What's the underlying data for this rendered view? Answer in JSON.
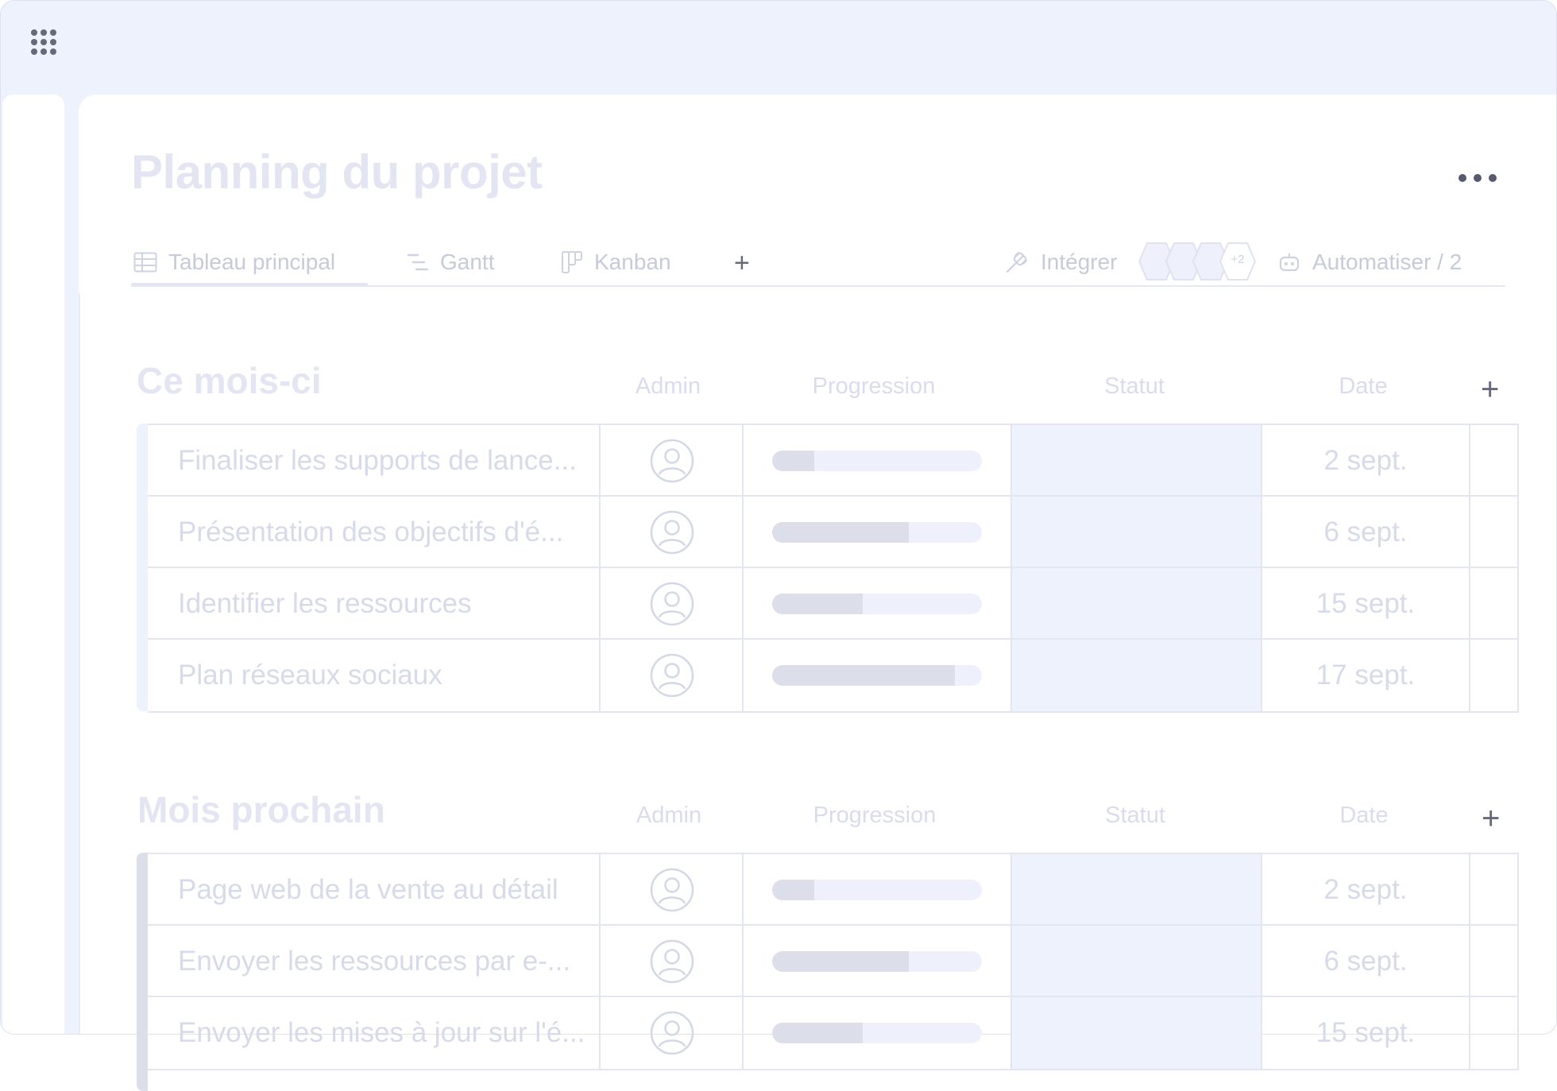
{
  "page": {
    "title": "Planning du projet"
  },
  "tabs": [
    {
      "label": "Tableau principal",
      "icon": "table-icon",
      "active": true
    },
    {
      "label": "Gantt",
      "icon": "gantt-icon"
    },
    {
      "label": "Kanban",
      "icon": "kanban-icon"
    }
  ],
  "toolbar": {
    "add_tab": "+",
    "integrate_label": "Intégrer",
    "integrate_icon": "plug-icon",
    "apps_more": "+2",
    "automate_label": "Automatiser / 2",
    "automate_icon": "robot-icon"
  },
  "columns": {
    "admin": "Admin",
    "progress": "Progression",
    "status": "Statut",
    "date": "Date",
    "add": "+"
  },
  "groups": [
    {
      "title": "Ce mois-ci",
      "color": "#eef2fd",
      "rows": [
        {
          "name": "Finaliser les supports de lance...",
          "progress": 0.2,
          "date": "2 sept."
        },
        {
          "name": "Présentation des objectifs d'é...",
          "progress": 0.65,
          "date": "6 sept."
        },
        {
          "name": "Identifier les ressources",
          "progress": 0.43,
          "date": "15 sept."
        },
        {
          "name": "Plan réseaux sociaux",
          "progress": 0.87,
          "date": "17 sept."
        }
      ]
    },
    {
      "title": "Mois prochain",
      "color": "#dcdfea",
      "rows": [
        {
          "name": "Page web de la vente au détail",
          "progress": 0.2,
          "date": "2 sept."
        },
        {
          "name": "Envoyer les ressources par e-...",
          "progress": 0.65,
          "date": "6 sept."
        },
        {
          "name": "Envoyer les mises à jour sur l'é...",
          "progress": 0.43,
          "date": "15 sept."
        }
      ]
    }
  ],
  "colors": {
    "frame_bg": "#eef2fd",
    "muted_text": "#d7dae8",
    "status_cell": "#eef2fd",
    "icon_dark": "#676879"
  }
}
